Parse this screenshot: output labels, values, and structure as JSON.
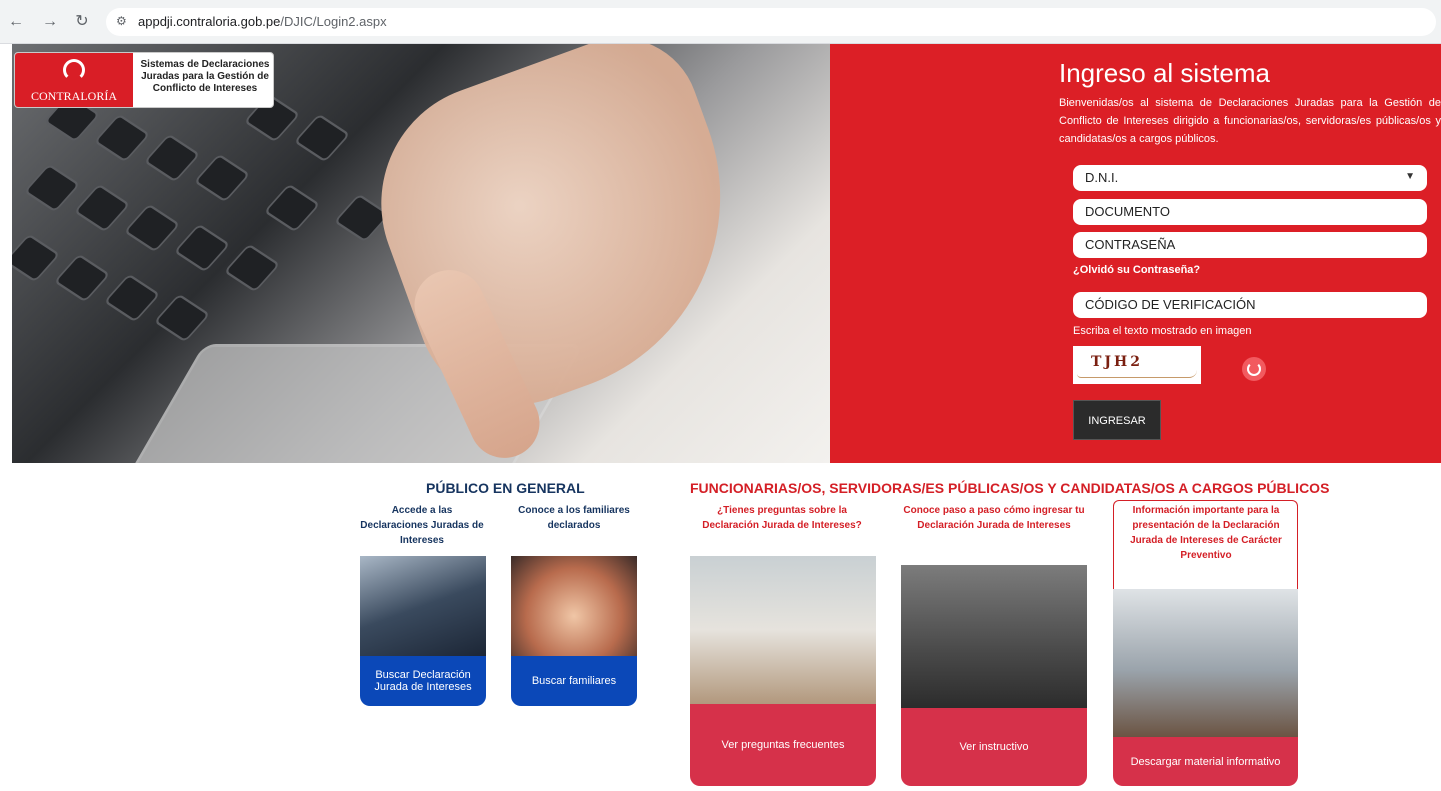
{
  "browser": {
    "url_host": "appdji.contraloria.gob.pe",
    "url_path": "/DJIC/Login2.aspx"
  },
  "logo": {
    "brand": "CONTRALORÍA",
    "subtitle": "Sistemas de Declaraciones Juradas para la Gestión de Conflicto de Intereses"
  },
  "login": {
    "title": "Ingreso al sistema",
    "description": "Bienvenidas/os al sistema de Declaraciones Juradas para la Gestión de Conflicto de Intereses dirigido a funcionarias/os, servidoras/es públicas/os y candidatas/os a cargos públicos.",
    "doc_type": "D.N.I.",
    "document_placeholder": "DOCUMENTO",
    "password_placeholder": "CONTRASEÑA",
    "forgot": "¿Olvidó su Contraseña?",
    "code_placeholder": "CÓDIGO DE VERIFICACIÓN",
    "captcha_hint": "Escriba el texto mostrado en imagen",
    "captcha_text": "TJH2",
    "submit": "INGRESAR"
  },
  "publico": {
    "title": "PÚBLICO EN GENERAL",
    "col1_title": "Accede a las Declaraciones Juradas de Intereses",
    "col1_button": "Buscar Declaración Jurada de Intereses",
    "col2_title": "Conoce a los familiares declarados",
    "col2_button": "Buscar familiares"
  },
  "funcionarios": {
    "title": "FUNCIONARIAS/OS, SERVIDORAS/ES PÚBLICAS/OS Y CANDIDATAS/OS A CARGOS PÚBLICOS",
    "col1_title": "¿Tienes preguntas sobre la Declaración Jurada de Intereses?",
    "col1_button": "Ver preguntas frecuentes",
    "col2_title": "Conoce paso a paso cómo ingresar tu Declaración Jurada de Intereses",
    "col2_button": "Ver instructivo",
    "col3_title": "Información importante para la presentación de la Declaración Jurada de Intereses de Carácter Preventivo",
    "col3_button": "Descargar material informativo"
  }
}
